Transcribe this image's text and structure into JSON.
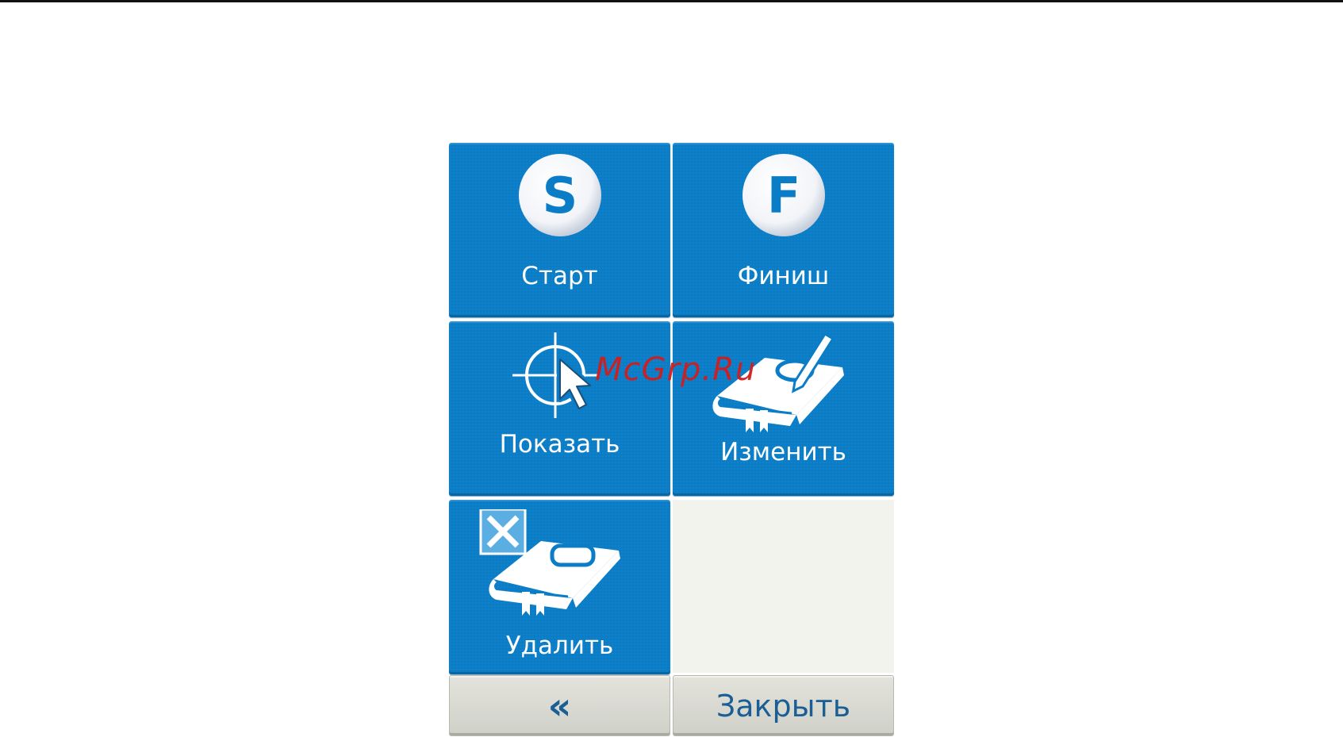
{
  "menu": {
    "start": {
      "label": "Старт",
      "icon": "start-s-circle-icon",
      "badge_letter": "S"
    },
    "finish": {
      "label": "Финиш",
      "icon": "finish-f-circle-icon",
      "badge_letter": "F"
    },
    "show": {
      "label": "Показать",
      "icon": "crosshair-cursor-icon"
    },
    "edit": {
      "label": "Изменить",
      "icon": "book-pencil-icon"
    },
    "delete": {
      "label": "Удалить",
      "icon": "book-delete-icon"
    }
  },
  "footer": {
    "back_label": "«",
    "close_label": "Закрыть"
  },
  "watermark": "McGrp.Ru",
  "colors": {
    "tile_blue": "#0b7dc6",
    "button_gray": "#d9d9d2",
    "button_text": "#1a5e94",
    "watermark_red": "#d21d1d"
  }
}
